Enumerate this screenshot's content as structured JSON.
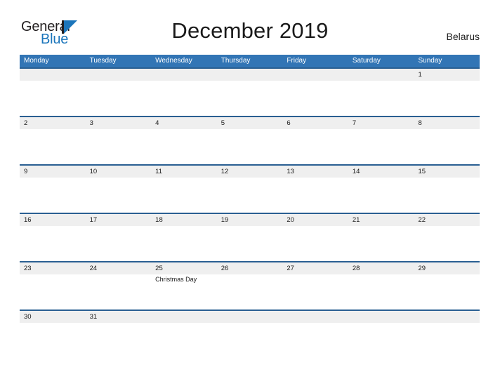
{
  "logo": {
    "primary_text": "General",
    "secondary_text": "Blue",
    "primary_color": "#231f20",
    "secondary_color": "#1b75bb",
    "triangle_icon": "blue-triangle-icon"
  },
  "header": {
    "title": "December 2019",
    "country": "Belarus"
  },
  "colors": {
    "header_blue": "#3275b5",
    "rule_blue": "#2a5f92",
    "band_gray": "#efefef",
    "text_dark": "#1a1a1a",
    "white": "#ffffff"
  },
  "calendar": {
    "month": "December",
    "year": "2019",
    "weekday_headers": [
      "Monday",
      "Tuesday",
      "Wednesday",
      "Thursday",
      "Friday",
      "Saturday",
      "Sunday"
    ],
    "weeks": [
      {
        "days": [
          {
            "number": "",
            "event": ""
          },
          {
            "number": "",
            "event": ""
          },
          {
            "number": "",
            "event": ""
          },
          {
            "number": "",
            "event": ""
          },
          {
            "number": "",
            "event": ""
          },
          {
            "number": "",
            "event": ""
          },
          {
            "number": "1",
            "event": ""
          }
        ]
      },
      {
        "days": [
          {
            "number": "2",
            "event": ""
          },
          {
            "number": "3",
            "event": ""
          },
          {
            "number": "4",
            "event": ""
          },
          {
            "number": "5",
            "event": ""
          },
          {
            "number": "6",
            "event": ""
          },
          {
            "number": "7",
            "event": ""
          },
          {
            "number": "8",
            "event": ""
          }
        ]
      },
      {
        "days": [
          {
            "number": "9",
            "event": ""
          },
          {
            "number": "10",
            "event": ""
          },
          {
            "number": "11",
            "event": ""
          },
          {
            "number": "12",
            "event": ""
          },
          {
            "number": "13",
            "event": ""
          },
          {
            "number": "14",
            "event": ""
          },
          {
            "number": "15",
            "event": ""
          }
        ]
      },
      {
        "days": [
          {
            "number": "16",
            "event": ""
          },
          {
            "number": "17",
            "event": ""
          },
          {
            "number": "18",
            "event": ""
          },
          {
            "number": "19",
            "event": ""
          },
          {
            "number": "20",
            "event": ""
          },
          {
            "number": "21",
            "event": ""
          },
          {
            "number": "22",
            "event": ""
          }
        ]
      },
      {
        "days": [
          {
            "number": "23",
            "event": ""
          },
          {
            "number": "24",
            "event": ""
          },
          {
            "number": "25",
            "event": "Christmas Day"
          },
          {
            "number": "26",
            "event": ""
          },
          {
            "number": "27",
            "event": ""
          },
          {
            "number": "28",
            "event": ""
          },
          {
            "number": "29",
            "event": ""
          }
        ]
      },
      {
        "days": [
          {
            "number": "30",
            "event": ""
          },
          {
            "number": "31",
            "event": ""
          },
          {
            "number": "",
            "event": ""
          },
          {
            "number": "",
            "event": ""
          },
          {
            "number": "",
            "event": ""
          },
          {
            "number": "",
            "event": ""
          },
          {
            "number": "",
            "event": ""
          }
        ]
      }
    ]
  }
}
